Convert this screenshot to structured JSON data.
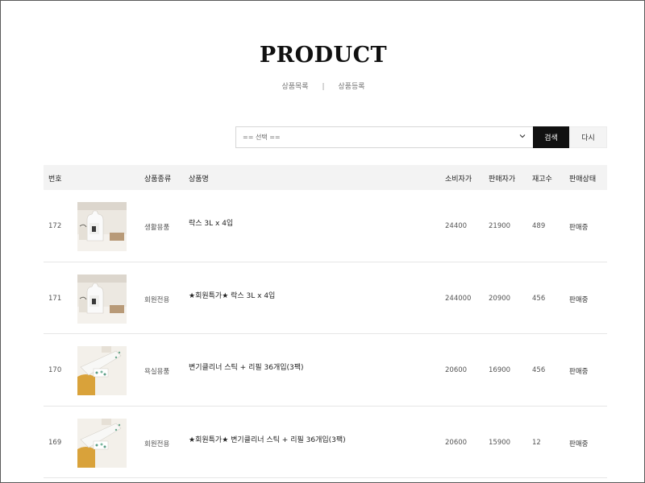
{
  "header": {
    "title": "PRODUCT",
    "subnav": [
      {
        "label": "상품목록"
      },
      {
        "label": "상품등록"
      }
    ],
    "separator": "|"
  },
  "search": {
    "select_value": "== 선택 ==",
    "search_label": "검색",
    "reset_label": "다시"
  },
  "table": {
    "columns": {
      "num": "번호",
      "type": "상품종류",
      "name": "상품명",
      "price": "소비자가",
      "sale": "판매자가",
      "stock": "재고수",
      "status": "판매상태"
    },
    "rows": [
      {
        "num": "172",
        "thumb": "bottle",
        "type": "생활용품",
        "name": "락스 3L x 4입",
        "price": "24400",
        "sale": "21900",
        "stock": "489",
        "status": "판매중"
      },
      {
        "num": "171",
        "thumb": "bottle",
        "type": "회원전용",
        "name": "★회원특가★ 락스 3L x 4입",
        "price": "244000",
        "sale": "20900",
        "stock": "456",
        "status": "판매중"
      },
      {
        "num": "170",
        "thumb": "toilet-cleaner",
        "type": "욕실용품",
        "name": "변기클리너 스틱 + 리필 36개입(3팩)",
        "price": "20600",
        "sale": "16900",
        "stock": "456",
        "status": "판매중"
      },
      {
        "num": "169",
        "thumb": "toilet-cleaner",
        "type": "회원전용",
        "name": "★회원특가★ 변기클리너 스틱 + 리필 36개입(3팩)",
        "price": "20600",
        "sale": "15900",
        "stock": "12",
        "status": "판매중"
      }
    ]
  },
  "colors": {
    "search_button": "#111111",
    "header_bg": "#f3f3f3",
    "row_border": "#e6e6e6"
  }
}
